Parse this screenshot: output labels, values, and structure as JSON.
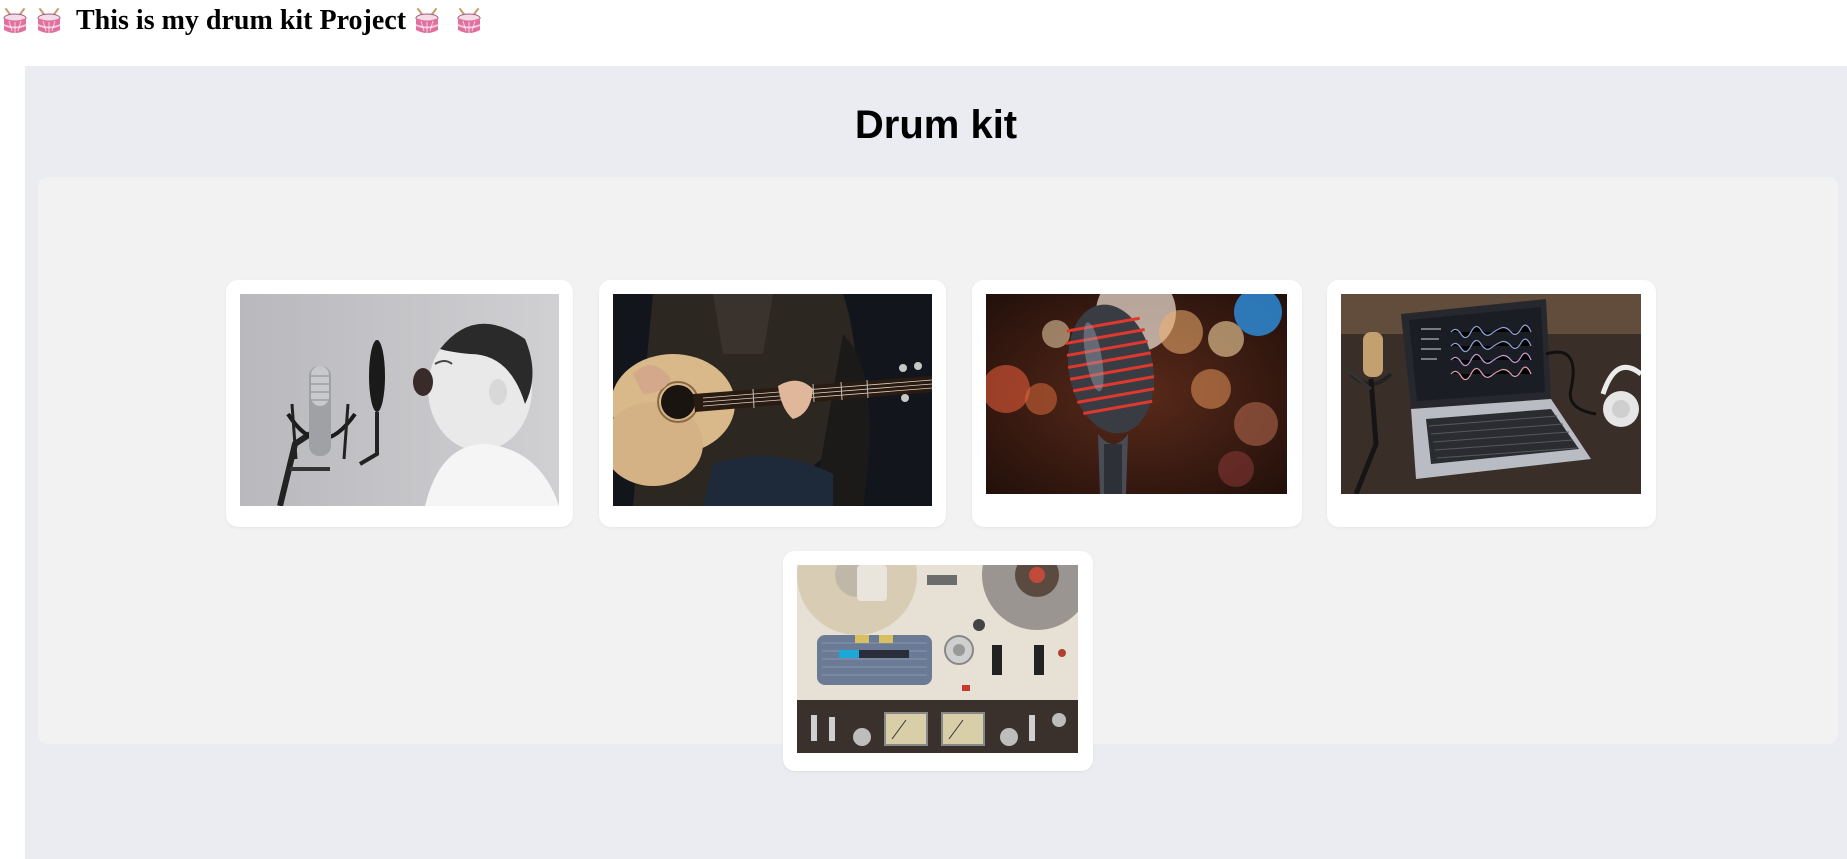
{
  "header": {
    "title": "This is my drum kit Project",
    "left_icons": [
      "drum-icon",
      "drum-icon"
    ],
    "right_icons": [
      "drum-icon",
      "drum-icon"
    ]
  },
  "main": {
    "heading": "Drum kit",
    "cards": [
      {
        "name": "singer-microphone-image"
      },
      {
        "name": "acoustic-guitar-image"
      },
      {
        "name": "vintage-microphone-image"
      },
      {
        "name": "laptop-audio-editing-image"
      },
      {
        "name": "reel-to-reel-recorder-image"
      }
    ]
  },
  "colors": {
    "panel_background": "#ebecf1",
    "gallery_background": "#f2f2f3",
    "card_background": "#ffffff"
  }
}
